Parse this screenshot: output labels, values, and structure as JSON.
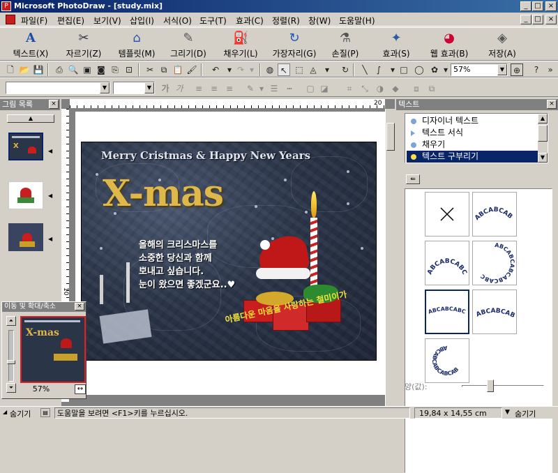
{
  "titlebar": {
    "title": "Microsoft PhotoDraw - [study.mix]",
    "btn_min": "_",
    "btn_max": "□",
    "btn_close": "×"
  },
  "menubar": {
    "items": [
      "파일(F)",
      "편집(E)",
      "보기(V)",
      "삽입(I)",
      "서식(O)",
      "도구(T)",
      "효과(C)",
      "정렬(R)",
      "창(W)",
      "도움말(H)"
    ]
  },
  "bigbar": {
    "buttons": [
      {
        "label": "텍스트(X)",
        "icon": "text-a-icon"
      },
      {
        "label": "자르기(Z)",
        "icon": "scissors-icon"
      },
      {
        "label": "템플릿(M)",
        "icon": "template-icon"
      },
      {
        "label": "그리기(D)",
        "icon": "pen-icon"
      },
      {
        "label": "채우기(L)",
        "icon": "paint-bucket-icon"
      },
      {
        "label": "가장자리(G)",
        "icon": "rotate-icon"
      },
      {
        "label": "손질(P)",
        "icon": "touch-up-icon"
      },
      {
        "label": "효과(S)",
        "icon": "effects-icon"
      },
      {
        "label": "웹 효과(B)",
        "icon": "web-effects-icon"
      },
      {
        "label": "저장(A)",
        "icon": "save-diamond-icon"
      }
    ]
  },
  "toolbar": {
    "zoom_value": "57%"
  },
  "leftpanel": {
    "title": "그림 목록"
  },
  "navigator": {
    "title": "이동 및 확대/축소",
    "zoom": "57%"
  },
  "ruler": {
    "top_mark": "20",
    "left_mark": "10"
  },
  "card": {
    "headline": "Merry Cristmas & Happy New Years",
    "big_title": "X-mas",
    "message_lines": [
      "올해의 크리스마스를",
      "소중한 당신과 함께",
      "보내고 싶습니다.",
      "눈이 왔으면 좋겠군요..♥"
    ],
    "curved_text": "아름다운 마음을 사랑하는 철미이가"
  },
  "rightpanel": {
    "title": "텍스트",
    "list": [
      {
        "label": "디자이너 텍스트",
        "selected": false
      },
      {
        "label": "텍스트 서식",
        "selected": false
      },
      {
        "label": "채우기",
        "selected": false
      },
      {
        "label": "텍스트 구부리기",
        "selected": true
      }
    ],
    "warp_sample": "ABCABCABC",
    "amount_label": "양(값):"
  },
  "statusbar": {
    "hide_left": "숨기기",
    "help": "도움말을 보려면 <F1>키를 누르십시오.",
    "coords": "19,84 x 14,55  cm",
    "hide_right": "숨기기"
  },
  "colors": {
    "title_blue": "#0a246a",
    "face": "#d4d0c8",
    "card_bg": "#2b3548",
    "gold": "#e0b84a",
    "curve_yellow": "#f2e23a"
  }
}
